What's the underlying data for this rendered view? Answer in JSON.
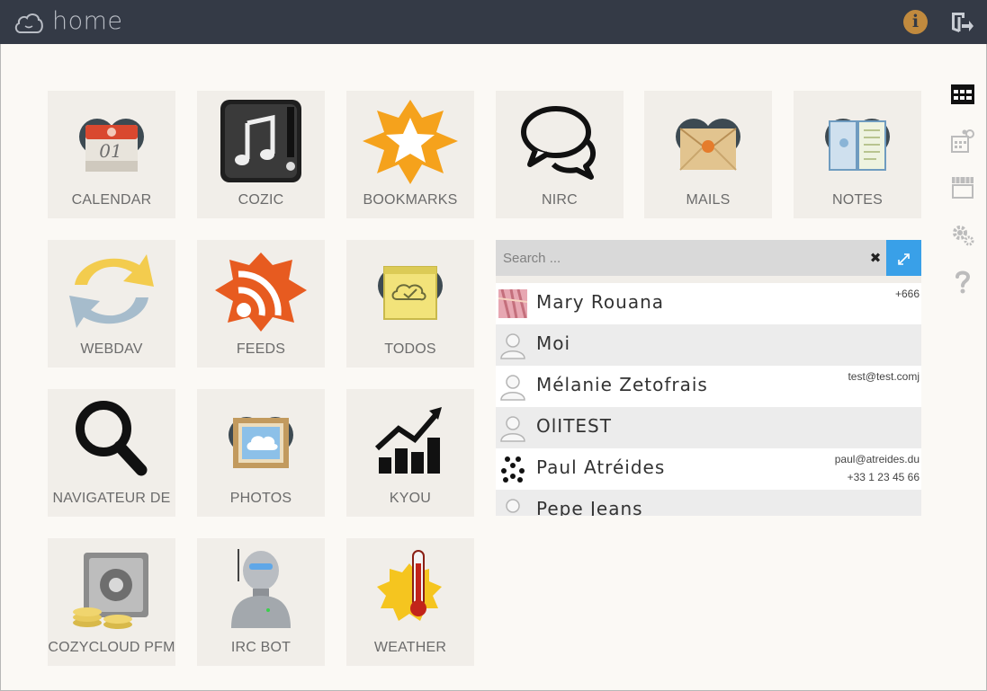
{
  "header": {
    "title": "home"
  },
  "apps": [
    {
      "label": "CALENDAR"
    },
    {
      "label": "COZIC"
    },
    {
      "label": "BOOKMARKS"
    },
    {
      "label": "NIRC"
    },
    {
      "label": "MAILS"
    },
    {
      "label": "NOTES"
    },
    {
      "label": "WEBDAV"
    },
    {
      "label": "FEEDS"
    },
    {
      "label": "TODOS"
    },
    {
      "label": "NAVIGATEUR DE"
    },
    {
      "label": "PHOTOS"
    },
    {
      "label": "KYOU"
    },
    {
      "label": "COZYCLOUD PFM"
    },
    {
      "label": "IRC BOT"
    },
    {
      "label": "WEATHER"
    }
  ],
  "calendar_icon_text": "01",
  "search": {
    "placeholder": "Search ...",
    "clear_glyph": "✖"
  },
  "contacts": [
    {
      "name": "Mary Rouana",
      "detail1": "+666",
      "detail2": ""
    },
    {
      "name": "Moi",
      "detail1": "",
      "detail2": ""
    },
    {
      "name": "Mélanie Zetofrais",
      "detail1": "test@test.comj",
      "detail2": ""
    },
    {
      "name": "OlITEST",
      "detail1": "",
      "detail2": ""
    },
    {
      "name": "Paul Atréides",
      "detail1": "paul@atreides.du",
      "detail2": "+33 1 23 45 66"
    },
    {
      "name": "Pepe Jeans",
      "detail1": "",
      "detail2": ""
    }
  ],
  "sidebar": {
    "items": [
      {
        "icon": "apps-grid-icon"
      },
      {
        "icon": "app-config-icon"
      },
      {
        "icon": "marketplace-icon"
      },
      {
        "icon": "settings-icon"
      },
      {
        "icon": "help-icon"
      }
    ]
  },
  "colors": {
    "topbar": "#343a46",
    "accent": "#39a0e8",
    "info": "#c18a3e",
    "background": "#fbf9f5",
    "tile": "#f1eee9"
  }
}
